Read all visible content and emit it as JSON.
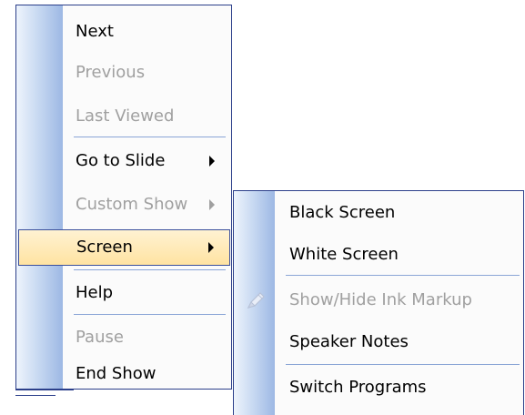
{
  "main_menu": {
    "items": [
      {
        "label": "Next",
        "enabled": true
      },
      {
        "label": "Previous",
        "enabled": false
      },
      {
        "label": "Last Viewed",
        "enabled": false
      },
      {
        "label": "Go to Slide",
        "enabled": true,
        "submenu": true
      },
      {
        "label": "Custom Show",
        "enabled": false,
        "submenu": true
      },
      {
        "label": "Screen",
        "enabled": true,
        "submenu": true,
        "highlighted": true
      },
      {
        "label": "Help",
        "enabled": true
      },
      {
        "label": "Pause",
        "enabled": false
      },
      {
        "label": "End Show",
        "enabled": true
      }
    ]
  },
  "screen_submenu": {
    "items": [
      {
        "label": "Black Screen",
        "enabled": true
      },
      {
        "label": "White Screen",
        "enabled": true
      },
      {
        "label": "Show/Hide Ink Markup",
        "enabled": false,
        "icon": "pen-icon"
      },
      {
        "label": "Speaker Notes",
        "enabled": true
      },
      {
        "label": "Switch Programs",
        "enabled": true
      }
    ]
  },
  "colors": {
    "menu_border": "#2b3f8a",
    "gradient_strip_light": "#eef4fc",
    "gradient_strip_dark": "#9db8e4",
    "highlight_fill": "#ffe3a2",
    "disabled_text": "#a0a0a0",
    "separator": "#8aa5d6"
  }
}
